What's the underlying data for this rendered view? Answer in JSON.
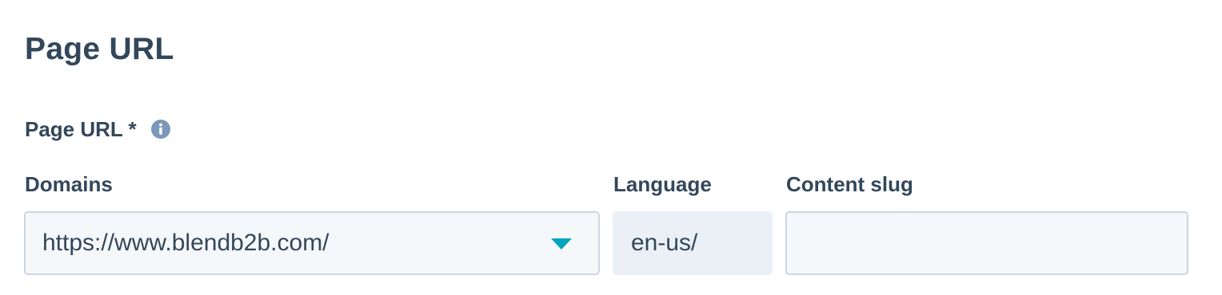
{
  "section": {
    "title": "Page URL"
  },
  "page_url_field": {
    "label": "Page URL *",
    "info_icon": "info-circle-icon"
  },
  "domains": {
    "label": "Domains",
    "selected_value": "https://www.blendb2b.com/",
    "caret_icon": "caret-down-icon",
    "caret_color": "#00a4bd"
  },
  "language": {
    "label": "Language",
    "value": "en-us/"
  },
  "content_slug": {
    "label": "Content slug",
    "value": "",
    "placeholder": ""
  }
}
